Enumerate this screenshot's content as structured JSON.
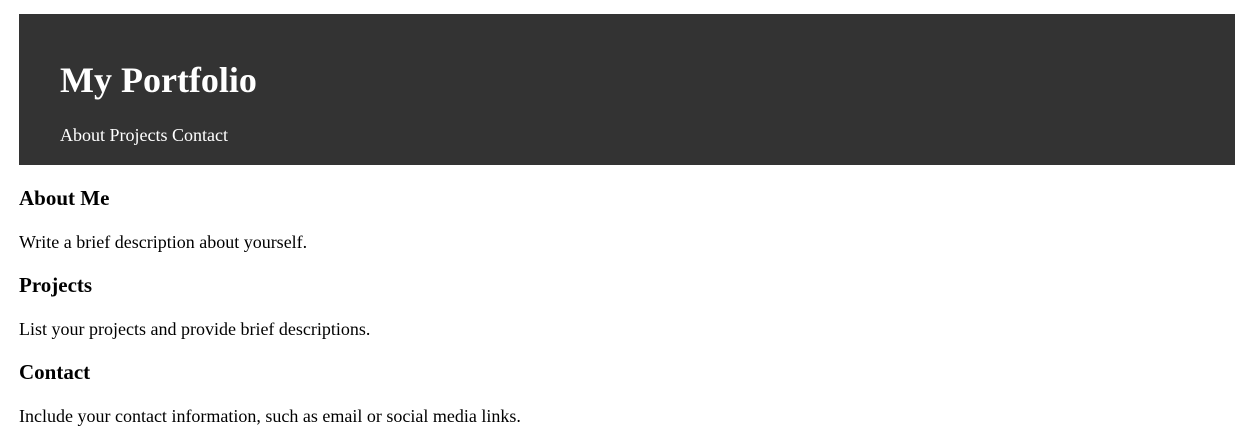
{
  "header": {
    "title": "My Portfolio",
    "nav": {
      "about": "About",
      "projects": "Projects",
      "contact": "Contact"
    },
    "background_color": "#333333"
  },
  "sections": {
    "about": {
      "heading": "About Me",
      "text": "Write a brief description about yourself."
    },
    "projects": {
      "heading": "Projects",
      "text": "List your projects and provide brief descriptions."
    },
    "contact": {
      "heading": "Contact",
      "text": "Include your contact information, such as email or social media links."
    }
  }
}
